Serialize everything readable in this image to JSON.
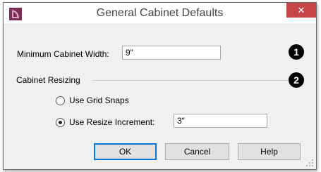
{
  "window": {
    "title": "General Cabinet Defaults",
    "close_symbol": "✕",
    "app_icon": "app-logo-icon",
    "close_color": "#c74446"
  },
  "min_width": {
    "label": "Minimum Cabinet Width:",
    "value": "9\""
  },
  "resizing": {
    "group_label": "Cabinet Resizing",
    "options": [
      {
        "label": "Use Grid Snaps",
        "selected": false
      },
      {
        "label": "Use Resize Increment:",
        "selected": true
      }
    ],
    "increment_value": "3\""
  },
  "callouts": [
    "1",
    "2"
  ],
  "buttons": {
    "ok": "OK",
    "cancel": "Cancel",
    "help": "Help"
  }
}
